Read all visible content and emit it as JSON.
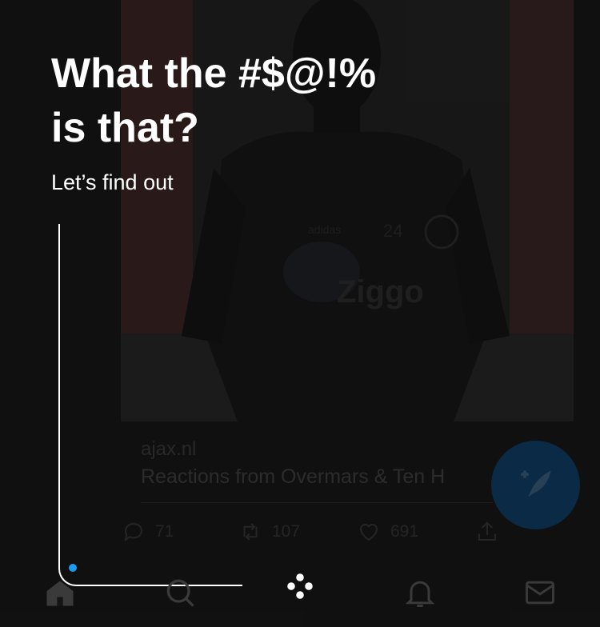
{
  "overlay": {
    "headline_line1": "What the #$@!%",
    "headline_line2": "is that?",
    "subtitle": "Let’s find out"
  },
  "tweet": {
    "jersey_number": "24",
    "sponsor": "Ziggo",
    "kit_brand": "adidas",
    "link_domain": "ajax.nl",
    "link_title": "Reactions from Overmars & Ten H",
    "replies": "71",
    "retweets": "107",
    "likes": "691"
  },
  "colors": {
    "background": "#151515",
    "overlay_text": "#ffffff",
    "accent": "#1d9bf0",
    "muted_text": "#3a3a3a"
  },
  "tabbar": {
    "items": [
      {
        "name": "home",
        "icon": "home-icon"
      },
      {
        "name": "search",
        "icon": "search-icon"
      },
      {
        "name": "spaces",
        "icon": "spaces-icon"
      },
      {
        "name": "notifications",
        "icon": "bell-icon"
      },
      {
        "name": "messages",
        "icon": "mail-icon"
      }
    ]
  }
}
